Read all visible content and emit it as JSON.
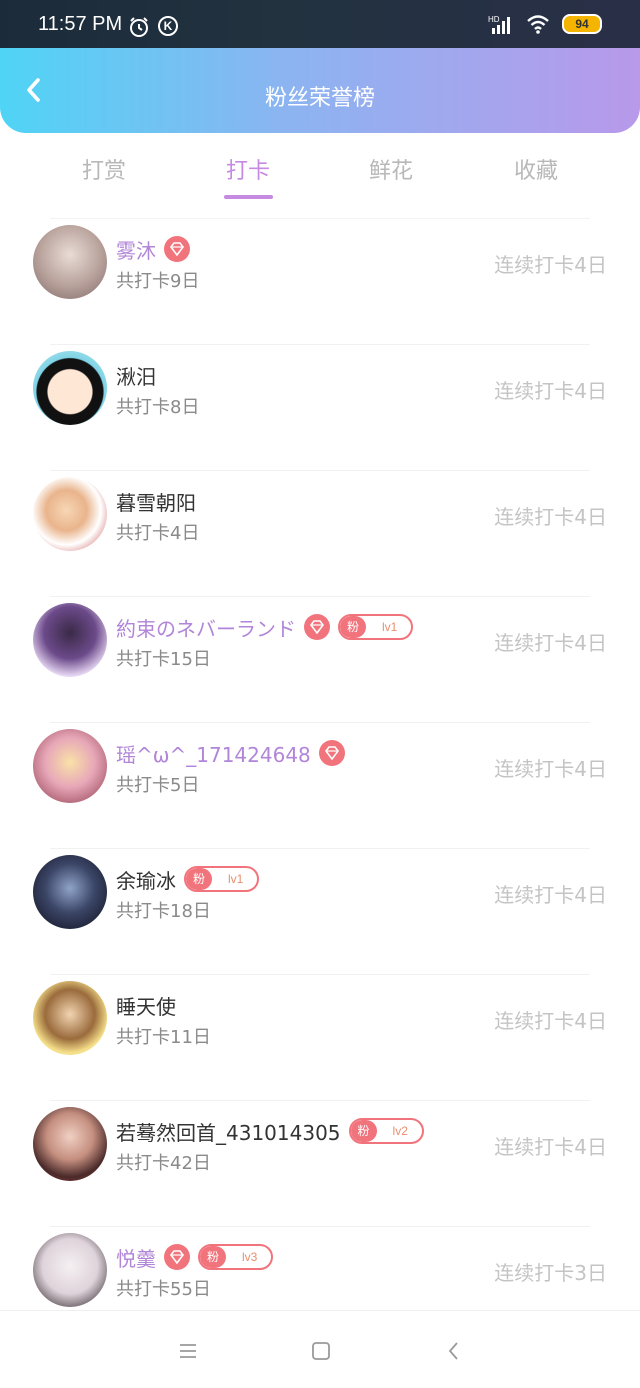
{
  "status": {
    "time": "11:57 PM",
    "battery": "94",
    "network": "HD"
  },
  "header": {
    "title": "粉丝荣誉榜"
  },
  "tabs": [
    {
      "label": "打赏"
    },
    {
      "label": "打卡"
    },
    {
      "label": "鲜花"
    },
    {
      "label": "收藏"
    }
  ],
  "active_tab": "打卡",
  "rows": [
    {
      "name": "雾沐",
      "vip": true,
      "diamond": true,
      "fan": null,
      "total": "共打卡9日",
      "streak": "连续打卡4日"
    },
    {
      "name": "湫汨",
      "vip": false,
      "diamond": false,
      "fan": null,
      "total": "共打卡8日",
      "streak": "连续打卡4日"
    },
    {
      "name": "暮雪朝阳",
      "vip": false,
      "diamond": false,
      "fan": null,
      "total": "共打卡4日",
      "streak": "连续打卡4日"
    },
    {
      "name": "約束のネバーランド",
      "vip": true,
      "diamond": true,
      "fan": {
        "label": "粉",
        "level": "lv1"
      },
      "total": "共打卡15日",
      "streak": "连续打卡4日"
    },
    {
      "name": "瑶^ω^_171424648",
      "vip": true,
      "diamond": true,
      "fan": null,
      "total": "共打卡5日",
      "streak": "连续打卡4日"
    },
    {
      "name": "余瑜冰",
      "vip": false,
      "diamond": false,
      "fan": {
        "label": "粉",
        "level": "lv1"
      },
      "total": "共打卡18日",
      "streak": "连续打卡4日"
    },
    {
      "name": "睡天使",
      "vip": false,
      "diamond": false,
      "fan": null,
      "total": "共打卡11日",
      "streak": "连续打卡4日"
    },
    {
      "name": "若蓦然回首_431014305",
      "vip": false,
      "diamond": false,
      "fan": {
        "label": "粉",
        "level": "lv2"
      },
      "total": "共打卡42日",
      "streak": "连续打卡4日"
    },
    {
      "name": "悦羹",
      "vip": true,
      "diamond": true,
      "fan": {
        "label": "粉",
        "level": "lv3"
      },
      "total": "共打卡55日",
      "streak": "连续打卡3日"
    }
  ],
  "colors": {
    "accent": "#c58be3",
    "vip_name": "#b185d8",
    "badge": "#f1747c",
    "header_start": "#4fd4f5",
    "header_end": "#b899ea"
  }
}
